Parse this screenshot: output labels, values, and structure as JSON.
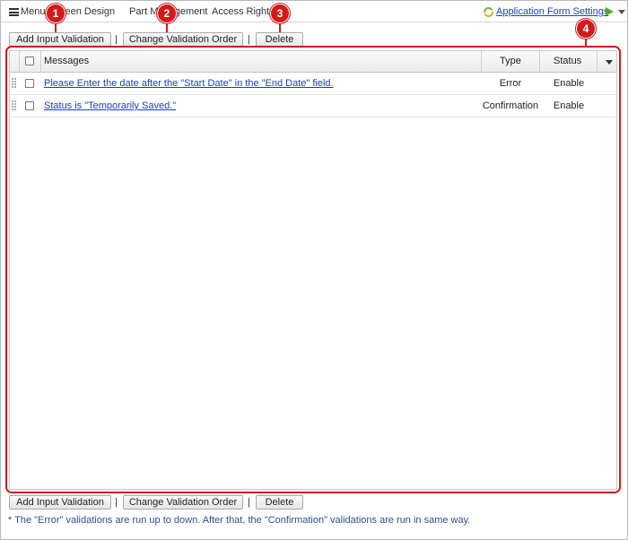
{
  "menu": {
    "menu_label": "Menu",
    "screen_design": "Screen Design",
    "part_management": "Part Management",
    "access_rights": "Access Rights",
    "app_form_settings": "Application Form Settings"
  },
  "toolbar": {
    "add_input_validation": "Add Input Validation",
    "change_validation_order": "Change Validation Order",
    "delete": "Delete",
    "separator": "|"
  },
  "annotations": [
    "1",
    "2",
    "3",
    "4"
  ],
  "grid": {
    "columns": {
      "messages": "Messages",
      "type": "Type",
      "status": "Status"
    },
    "rows": [
      {
        "message": "Please Enter the date after the \"Start Date\" in the \"End Date\" field.",
        "type": "Error",
        "status": "Enable"
      },
      {
        "message": "Status is \"Temporarily Saved.\"",
        "type": "Confirmation",
        "status": "Enable"
      }
    ]
  },
  "footer_note": "* The \"Error\" validations are run up to down. After that, the \"Confirmation\" validations are run in same way.",
  "colors": {
    "annotation": "#d11b1b",
    "link": "#1a3fc4",
    "play": "#4caf2c"
  },
  "icons": [
    "menu-icon",
    "refresh-icon",
    "play-icon",
    "chevron-down-icon",
    "drag-handle-icon"
  ]
}
